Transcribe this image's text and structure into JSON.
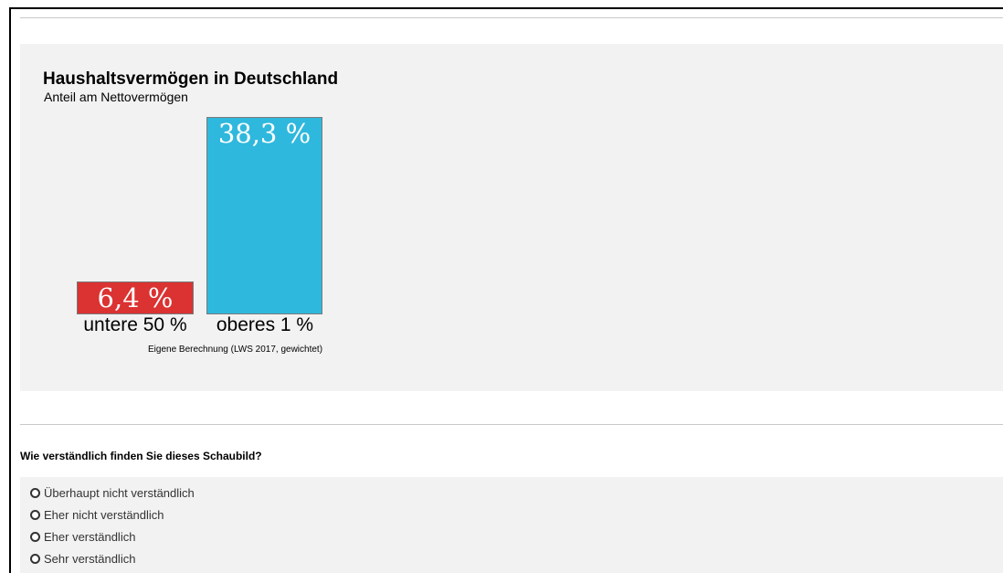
{
  "chart": {
    "title": "Haushaltsvermögen in Deutschland",
    "subtitle": "Anteil am Nettovermögen",
    "source": "Eigene Berechnung (LWS 2017, gewichtet)",
    "colors": {
      "untere": "#db3232",
      "oberes": "#2fb8dd"
    }
  },
  "chart_data": {
    "type": "bar",
    "categories": [
      "untere 50 %",
      "oberes 1 %"
    ],
    "values": [
      6.4,
      38.3
    ],
    "value_labels": [
      "6,4 %",
      "38,3 %"
    ],
    "title": "Haushaltsvermögen in Deutschland",
    "subtitle": "Anteil am Nettovermögen",
    "ylim": [
      0,
      38.3
    ],
    "grid": false
  },
  "question": {
    "text": "Wie verständlich finden Sie dieses Schaubild?",
    "options": [
      "Überhaupt nicht verständlich",
      "Eher nicht verständlich",
      "Eher verständlich",
      "Sehr verständlich"
    ]
  }
}
